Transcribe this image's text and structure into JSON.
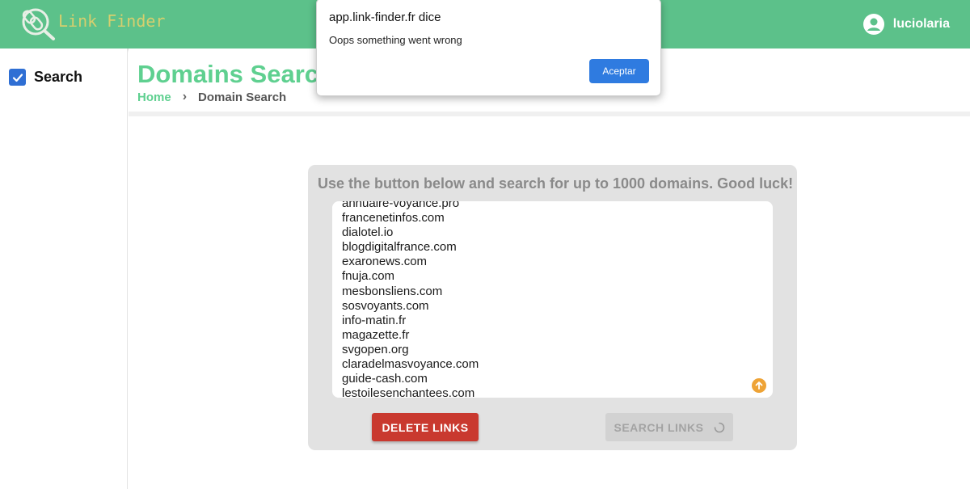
{
  "app": {
    "logo_text": "Link Finder",
    "username": "luciolaria"
  },
  "sidebar": {
    "items": [
      {
        "label": "Search",
        "checked": true
      }
    ]
  },
  "header": {
    "title": "Domains Search",
    "breadcrumb": {
      "home": "Home",
      "separator": "›",
      "current": "Domain Search"
    }
  },
  "main": {
    "instructions": "Use the button below and search for up to 1000 domains. Good luck!",
    "domains": [
      "annuaire-voyance.pro",
      "francenetinfos.com",
      "dialotel.io",
      "blogdigitalfrance.com",
      "exaronews.com",
      "fnuja.com",
      "mesbonsliens.com",
      "sosvoyants.com",
      "info-matin.fr",
      "magazette.fr",
      "svgopen.org",
      "claradelmasvoyance.com",
      "guide-cash.com",
      "lestoilesenchantees.com"
    ],
    "delete_label": "DELETE LINKS",
    "search_label": "SEARCH LINKS"
  },
  "dialog": {
    "title": "app.link-finder.fr dice",
    "message": "Oops something went wrong",
    "ok_label": "Aceptar"
  },
  "colors": {
    "topbar": "#5cc18a",
    "title_green": "#5fd090",
    "delete_red": "#c9392f",
    "dialog_blue": "#2f7be0",
    "checkbox_blue": "#2f6fd4"
  }
}
